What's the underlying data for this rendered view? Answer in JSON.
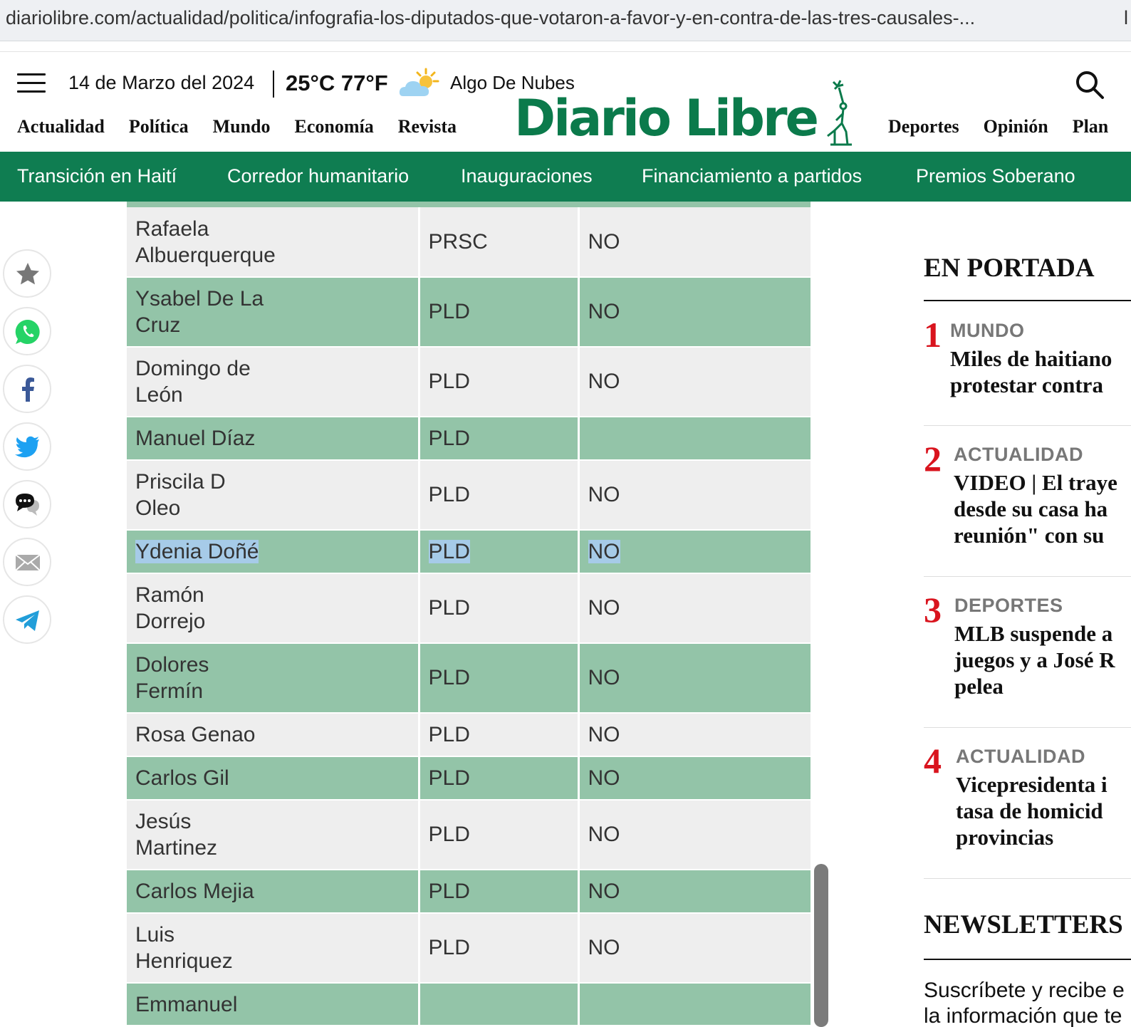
{
  "browser": {
    "url": "diariolibre.com/actualidad/politica/infografia-los-diputados-que-votaron-a-favor-y-en-contra-de-las-tres-causales-...",
    "url_extra": "l"
  },
  "header": {
    "date": "14 de Marzo del 2024",
    "temperature": "25°C 77°F",
    "weather": "Algo De Nubes",
    "logo": "Diario Libre",
    "nav_left": [
      "Actualidad",
      "Política",
      "Mundo",
      "Economía",
      "Revista"
    ],
    "nav_right": [
      "Deportes",
      "Opinión",
      "Plan"
    ]
  },
  "topics": [
    "Transición en Haití",
    "Corredor humanitario",
    "Inauguraciones",
    "Financiamiento a partidos",
    "Premios Soberano"
  ],
  "table": {
    "rows": [
      {
        "name": [
          "Rafaela",
          "Albuerquerque"
        ],
        "party": "PRSC",
        "vote": "NO"
      },
      {
        "name": [
          "Ysabel De La",
          "Cruz"
        ],
        "party": "PLD",
        "vote": "NO"
      },
      {
        "name": [
          "Domingo de",
          "León"
        ],
        "party": "PLD",
        "vote": "NO"
      },
      {
        "name": [
          "Manuel Díaz"
        ],
        "party": "PLD",
        "vote": ""
      },
      {
        "name": [
          "Priscila D",
          "Oleo"
        ],
        "party": "PLD",
        "vote": "NO"
      },
      {
        "name": [
          "Ydenia Doñé"
        ],
        "party": "PLD",
        "vote": "NO"
      },
      {
        "name": [
          "Ramón",
          "Dorrejo"
        ],
        "party": "PLD",
        "vote": "NO"
      },
      {
        "name": [
          "Dolores",
          "Fermín"
        ],
        "party": "PLD",
        "vote": "NO"
      },
      {
        "name": [
          "Rosa Genao"
        ],
        "party": "PLD",
        "vote": "NO"
      },
      {
        "name": [
          "Carlos Gil"
        ],
        "party": "PLD",
        "vote": "NO"
      },
      {
        "name": [
          "Jesús",
          "Martinez"
        ],
        "party": "PLD",
        "vote": "NO"
      },
      {
        "name": [
          "Carlos Mejia"
        ],
        "party": "PLD",
        "vote": "NO"
      },
      {
        "name": [
          "Luis",
          "Henriquez"
        ],
        "party": "PLD",
        "vote": "NO"
      },
      {
        "name": [
          "Emmanuel"
        ],
        "party": "",
        "vote": ""
      }
    ]
  },
  "rail": {
    "portada_title": "EN PORTADA",
    "items": [
      {
        "num": "1",
        "category": "MUNDO",
        "lines": [
          "Miles de haitiano",
          "protestar contra"
        ]
      },
      {
        "num": "2",
        "category": "ACTUALIDAD",
        "lines": [
          "VIDEO | El traye",
          "desde su casa ha",
          "reunión\" con su"
        ]
      },
      {
        "num": "3",
        "category": "DEPORTES",
        "lines": [
          "MLB suspende a",
          "juegos y a José R",
          "pelea"
        ]
      },
      {
        "num": "4",
        "category": "ACTUALIDAD",
        "lines": [
          "Vicepresidenta i",
          "tasa de homicid",
          "provincias"
        ]
      }
    ],
    "newsletters_title": "NEWSLETTERS",
    "newsletters_text": [
      "Suscríbete y recibe e",
      "la información que te"
    ]
  },
  "colors": {
    "brand_green": "#0f7d51",
    "row_green": "#93c4a8",
    "row_gray": "#eeeeee",
    "rank_red": "#d9141e",
    "highlight_blue": "#a6cbe8"
  },
  "share_icons": [
    "star-icon",
    "whatsapp-icon",
    "facebook-icon",
    "twitter-icon",
    "comments-icon",
    "email-icon",
    "telegram-icon"
  ]
}
